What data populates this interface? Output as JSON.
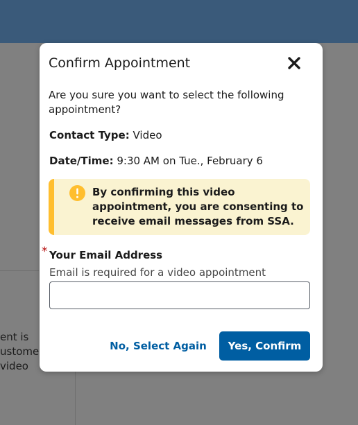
{
  "background": {
    "partial_text_lines": [
      "ent is",
      "ustomer",
      "video"
    ]
  },
  "modal": {
    "title": "Confirm Appointment",
    "close_icon": "close-x-icon",
    "intro": "Are you sure you want to select the following appointment?",
    "contact_type": {
      "label": "Contact Type:",
      "value": " Video"
    },
    "date_time": {
      "label": "Date/Time:",
      "value": " 9:30 AM on Tue., February 6"
    },
    "alert": {
      "icon": "warning-exclamation-icon",
      "text": "By confirming this video appointment, you are consenting to receive email messages from SSA."
    },
    "email": {
      "required_mark": "*",
      "label": "Your Email Address",
      "hint": "Email is required for a video appointment",
      "value": ""
    },
    "buttons": {
      "secondary": "No, Select Again",
      "primary": "Yes, Confirm"
    }
  },
  "colors": {
    "header_bar": "#3a5a7a",
    "primary_button": "#005ea2",
    "alert_background": "#faf3d1",
    "alert_accent": "#ffbe2e",
    "required_star": "#b50909"
  }
}
